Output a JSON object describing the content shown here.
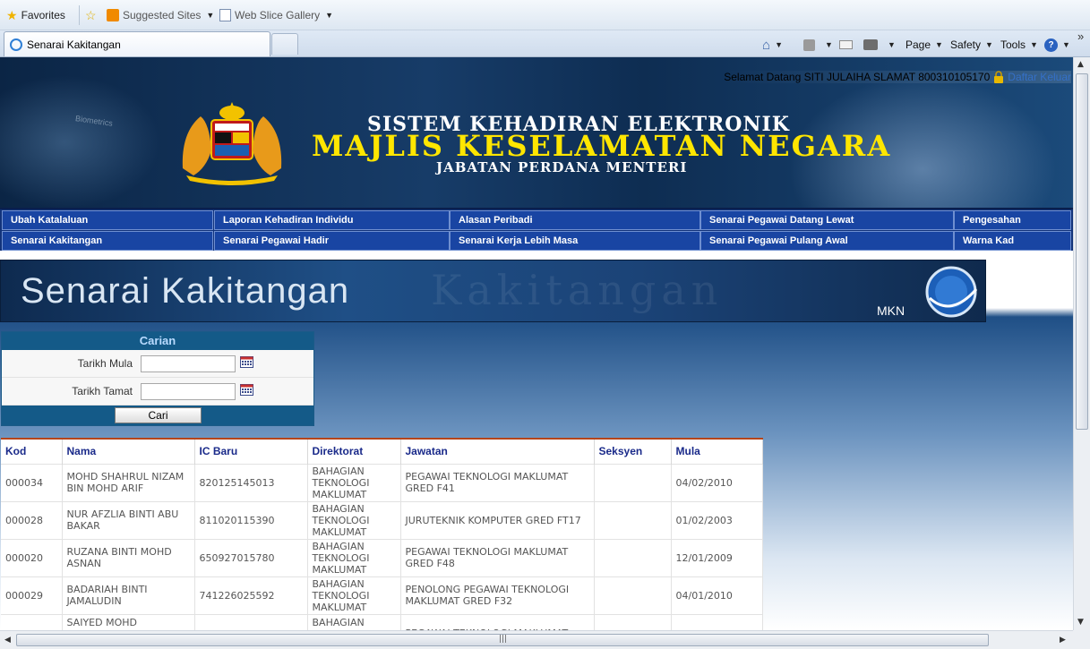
{
  "browser": {
    "favorites_label": "Favorites",
    "suggested_sites": "Suggested Sites",
    "web_slice_gallery": "Web Slice Gallery",
    "tab_title": "Senarai Kakitangan",
    "commands": {
      "page": "Page",
      "safety": "Safety",
      "tools": "Tools"
    },
    "chevron": "»"
  },
  "header": {
    "welcome_text": "Selamat Datang SITI JULAIHA SLAMAT 800310105170",
    "logout_label": "Daftar Keluar",
    "title_line1": "SISTEM KEHADIRAN ELEKTRONIK",
    "title_line2": "MAJLIS KESELAMATAN NEGARA",
    "title_line3": "JABATAN PERDANA MENTERI",
    "side_text": "Biometrics"
  },
  "nav": {
    "row1": [
      "Ubah Katalaluan",
      "Laporan Kehadiran Individu",
      "Alasan Peribadi",
      "Senarai Pegawai Datang Lewat",
      "Pengesahan"
    ],
    "row2": [
      "Senarai Kakitangan",
      "Senarai Pegawai Hadir",
      "Senarai Kerja Lebih Masa",
      "Senarai Pegawai Pulang Awal",
      "Warna Kad"
    ]
  },
  "banner": {
    "title": "Senarai Kakitangan",
    "ghost": "Kakitangan",
    "brand": "MKN"
  },
  "search": {
    "heading": "Carian",
    "start_label": "Tarikh Mula",
    "end_label": "Tarikh Tamat",
    "start_value": "",
    "end_value": "",
    "button_label": "Cari"
  },
  "table": {
    "headers": [
      "Kod",
      "Nama",
      "IC Baru",
      "Direktorat",
      "Jawatan",
      "Seksyen",
      "Mula"
    ],
    "rows": [
      [
        "000034",
        "MOHD SHAHRUL NIZAM BIN MOHD ARIF",
        "820125145013",
        "BAHAGIAN TEKNOLOGI MAKLUMAT",
        "PEGAWAI TEKNOLOGI MAKLUMAT GRED F41",
        "",
        "04/02/2010"
      ],
      [
        "000028",
        "NUR AFZLIA BINTI ABU BAKAR",
        "811020115390",
        "BAHAGIAN TEKNOLOGI MAKLUMAT",
        "JURUTEKNIK KOMPUTER GRED FT17",
        "",
        "01/02/2003"
      ],
      [
        "000020",
        "RUZANA BINTI MOHD ASNAN",
        "650927015780",
        "BAHAGIAN TEKNOLOGI MAKLUMAT",
        "PEGAWAI TEKNOLOGI MAKLUMAT GRED F48",
        "",
        "12/01/2009"
      ],
      [
        "000029",
        "BADARIAH BINTI JAMALUDIN",
        "741226025592",
        "BAHAGIAN TEKNOLOGI MAKLUMAT",
        "PENOLONG PEGAWAI TEKNOLOGI MAKLUMAT GRED F32",
        "",
        "04/01/2010"
      ],
      [
        "",
        "SAIYED MOHD",
        "",
        "BAHAGIAN",
        "PEGAWAI TEKNOLOGI MAKLUMAT",
        "",
        ""
      ]
    ]
  },
  "colors": {
    "header_bg": "#0e2d52",
    "nav_bg": "#1945a3",
    "title_yellow": "#ffe600",
    "search_head": "#145a88",
    "table_header_border": "#b5451b",
    "table_header_text": "#1a2a8a"
  }
}
